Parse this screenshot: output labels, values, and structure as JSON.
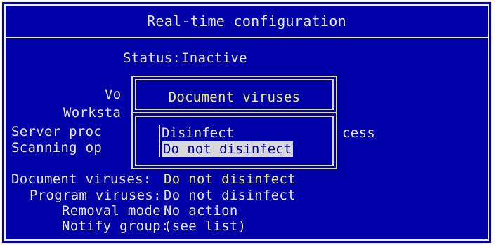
{
  "window": {
    "title": "Real-time configuration"
  },
  "status": {
    "label": "Status:",
    "value": "Inactive"
  },
  "background_fields": {
    "vo": "Vo",
    "worksta": "Worksta",
    "server_proc": "Server proc",
    "server_proc_tail": "cess",
    "scanning_op": "Scanning op"
  },
  "settings": [
    {
      "label": "Document viruses:",
      "value": "Do not disinfect",
      "highlighted": true
    },
    {
      "label": "Program viruses:",
      "value": "Do not disinfect",
      "highlighted": false
    },
    {
      "label": "Removal mode:",
      "value": "No action",
      "highlighted": false
    },
    {
      "label": "Notify group:",
      "value": "(see list)",
      "highlighted": false
    }
  ],
  "popup": {
    "title": "Document viruses",
    "options": [
      "Disinfect",
      "Do not disinfect"
    ],
    "selected_index": 1
  },
  "colors": {
    "background": "#0000a8",
    "text": "#e8e8e8",
    "highlight": "#f0f060",
    "selection_bg": "#d8d8d8"
  }
}
